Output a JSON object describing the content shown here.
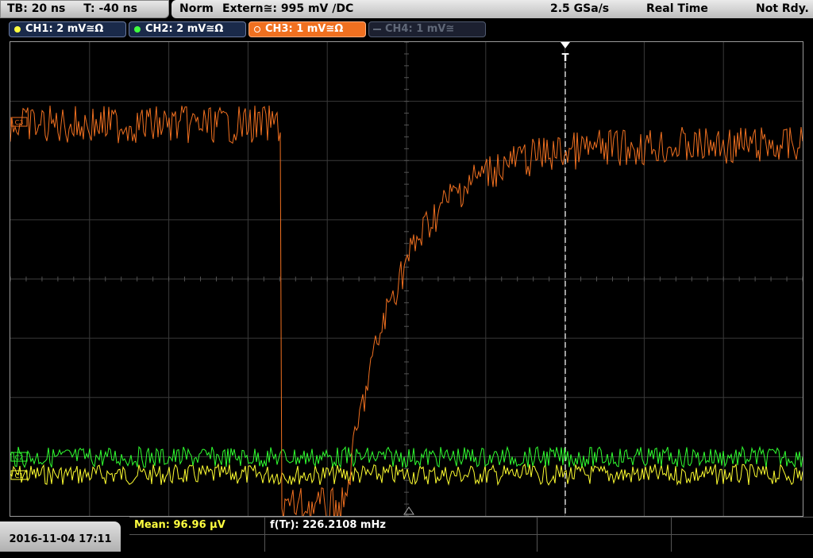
{
  "topbar": {
    "timebase": "TB: 20 ns",
    "trigger_time": "T: -40 ns",
    "trigger_mode": "Norm",
    "trigger_source": "Extern≅: 995 mV ∕DC",
    "sample_rate": "2.5 GSa/s",
    "acquisition": "Real Time",
    "status": "Not Rdy."
  },
  "channels": [
    {
      "label": "CH1: 2 mV≅Ω",
      "color": "#ffff40"
    },
    {
      "label": "CH2: 2 mV≅Ω",
      "color": "#40ff40"
    },
    {
      "label": "CH3: 1 mV≅Ω",
      "color": "#f07020"
    },
    {
      "label": "CH4: 1 mV≅",
      "color": "#606878"
    }
  ],
  "markers": {
    "trigger": "T",
    "ch3": "C3",
    "ch2": "C2",
    "ch1": "C1"
  },
  "bottom": {
    "datetime": "2016-11-04 17:11",
    "mean": "Mean: 96.96 µV",
    "frequency": "f(Tr): 226.2108 mHz"
  }
}
